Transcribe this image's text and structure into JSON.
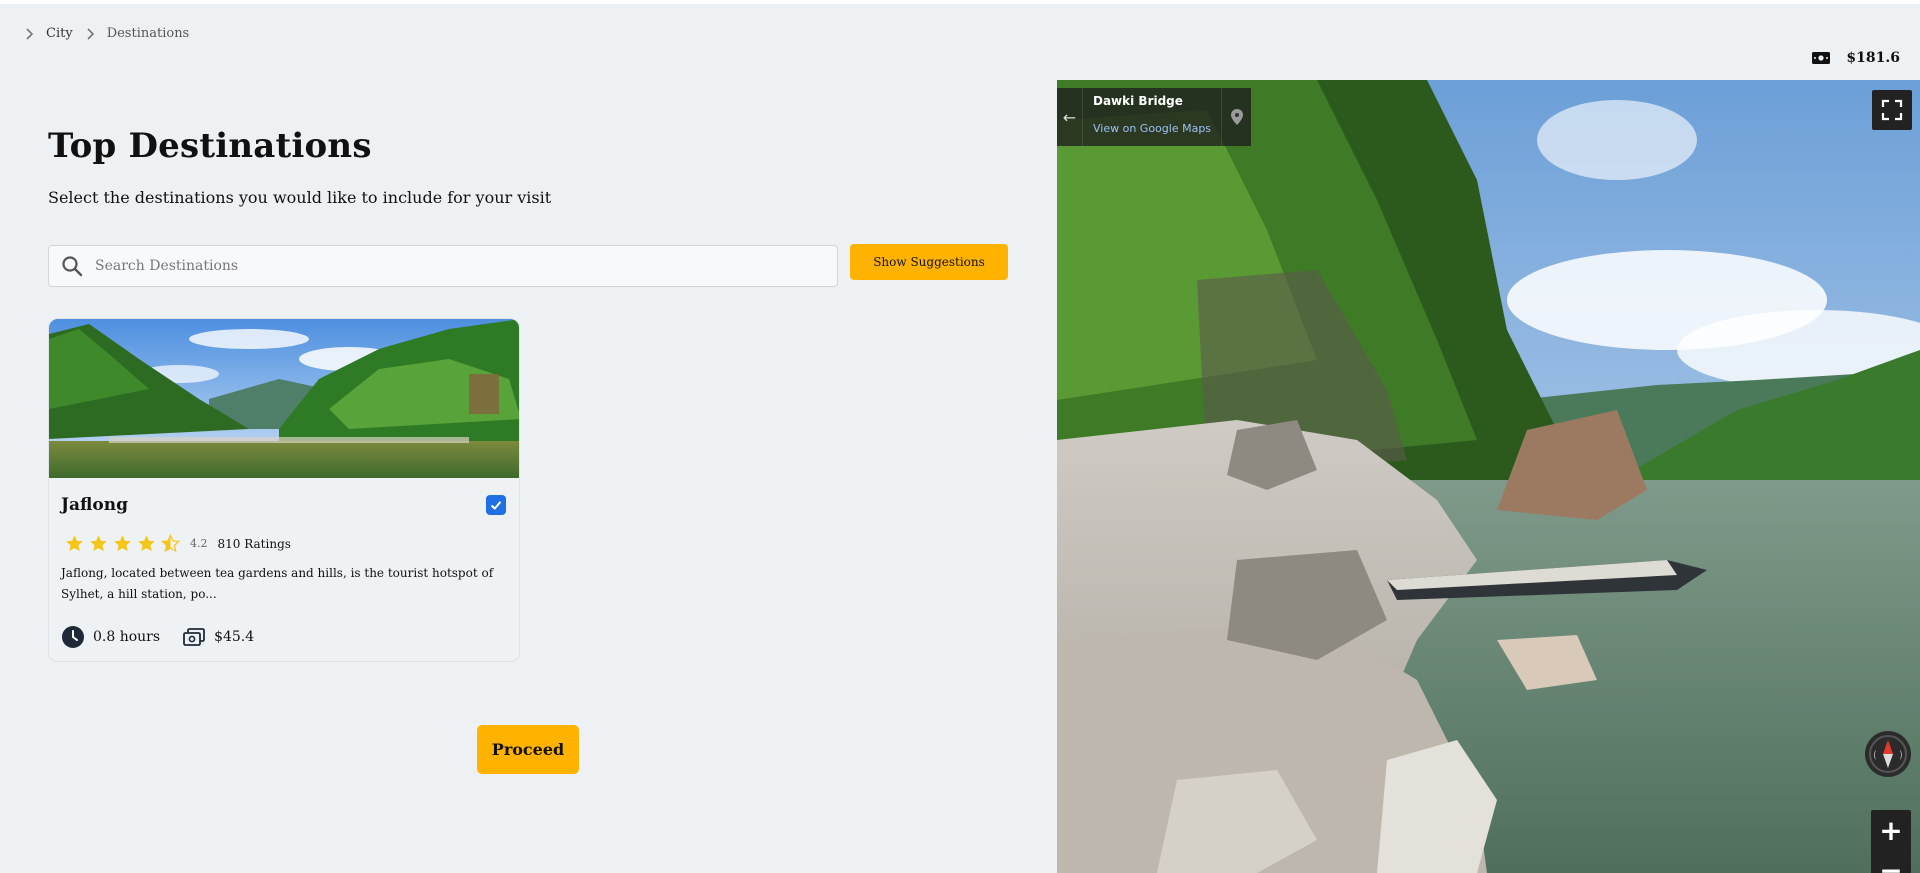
{
  "breadcrumb": {
    "items": [
      "City",
      "Destinations"
    ]
  },
  "budget": {
    "icon": "money-icon",
    "amount": "$181.6"
  },
  "header": {
    "title": "Top Destinations",
    "subtitle": "Select the destinations you would like to include for your visit"
  },
  "search": {
    "placeholder": "Search Destinations",
    "value": ""
  },
  "suggestions_button": {
    "label": "Show Suggestions"
  },
  "destinations": [
    {
      "name": "Jaflong",
      "selected": true,
      "stars": 4.5,
      "rating": "4.2",
      "ratings_count": "810 Ratings",
      "description": "Jaflong, located between tea gardens and hills, is the tourist hotspot of Sylhet, a hill station, po...",
      "duration": "0.8 hours",
      "cost": "$45.4"
    }
  ],
  "proceed_button": {
    "label": "Proceed"
  },
  "street_view": {
    "place": "Dawki Bridge",
    "link": "View on Google Maps",
    "zoom_in": "+",
    "zoom_out": "−"
  },
  "colors": {
    "accent": "#ffb300",
    "checkbox": "#1f6fe5",
    "star": "#f5c518",
    "background": "#edf1f3"
  }
}
